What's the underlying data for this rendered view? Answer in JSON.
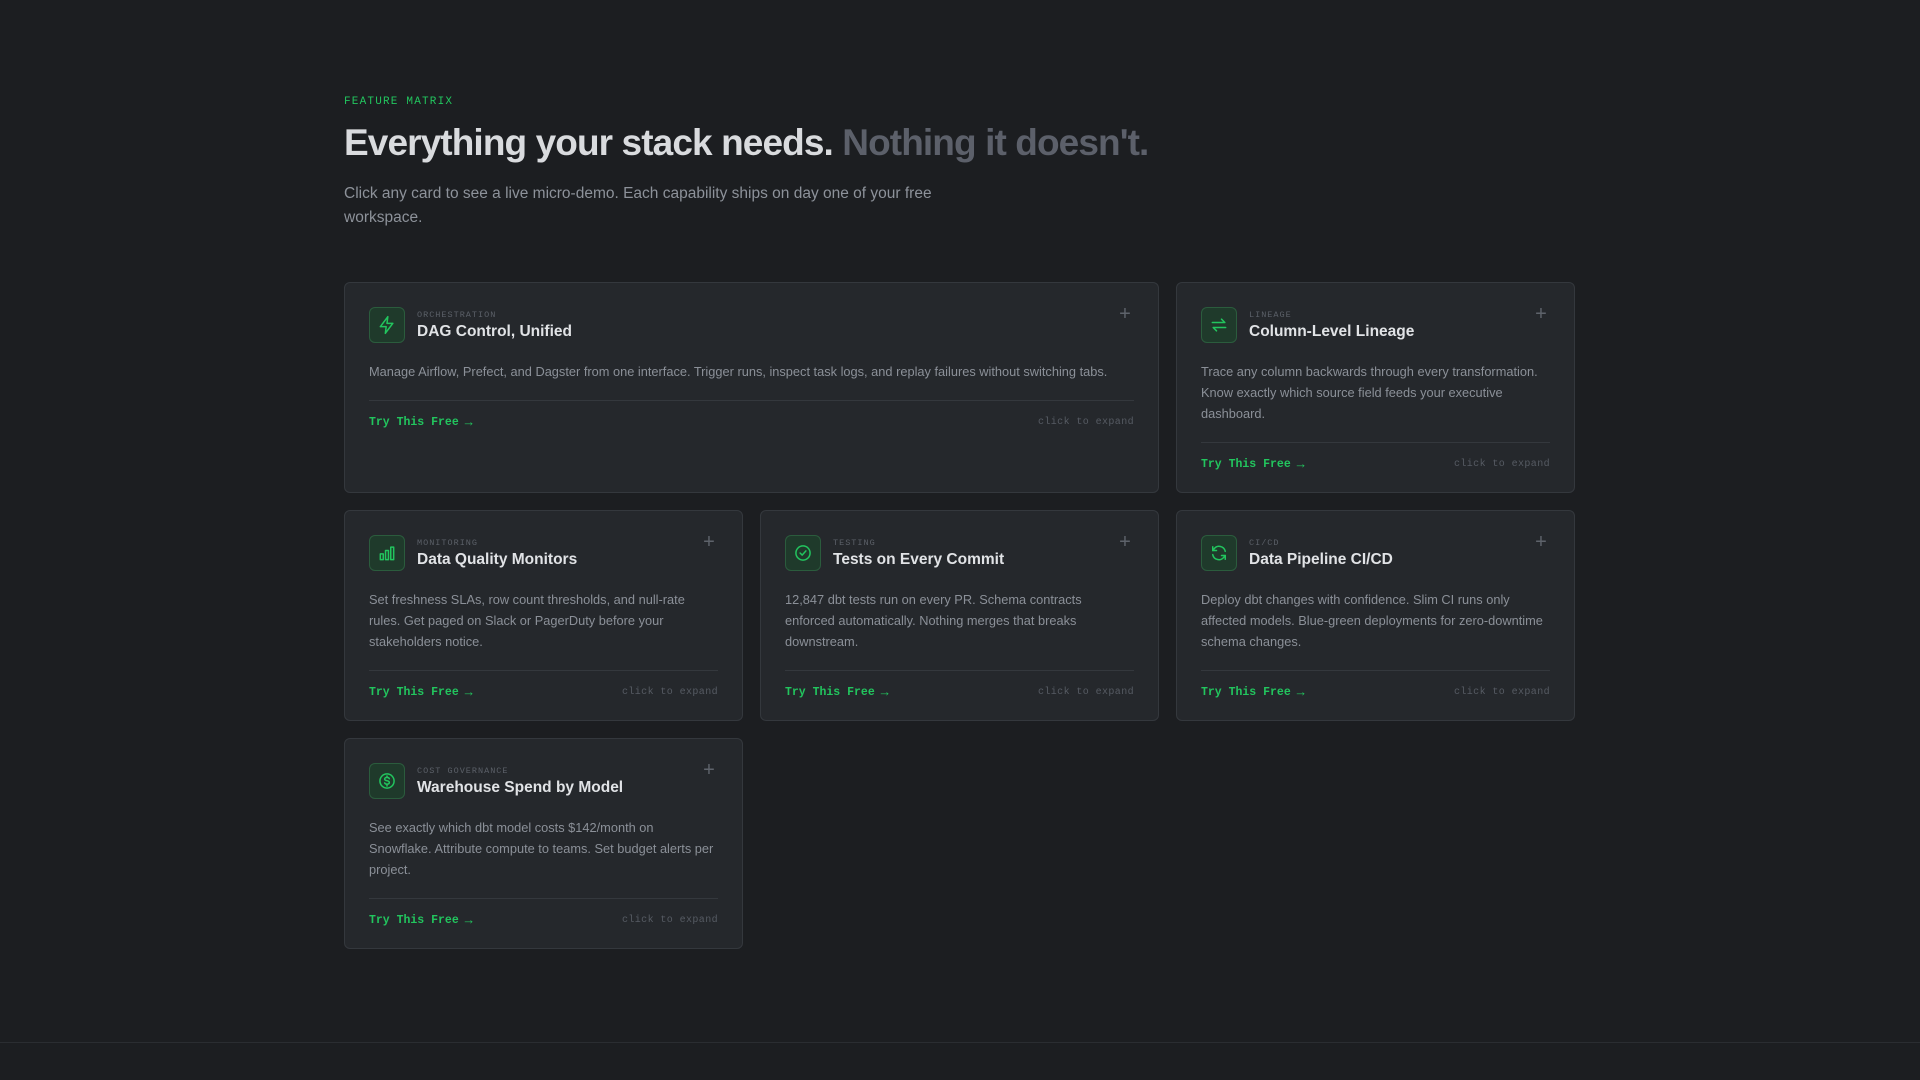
{
  "section": {
    "eyebrow": "FEATURE MATRIX",
    "headline_main": "Everything your stack needs.",
    "headline_muted": "Nothing it doesn't.",
    "subtitle": "Click any card to see a live micro-demo. Each capability ships on day one of your free workspace."
  },
  "colors": {
    "accent": "#22c55e",
    "background": "#1c1e21",
    "card": "#25282c"
  },
  "cards": [
    {
      "category": "ORCHESTRATION",
      "title": "DAG Control, Unified",
      "description": "Manage Airflow, Prefect, and Dagster from one interface. Trigger runs, inspect task logs, and replay failures without switching tabs.",
      "cta": "Try This Free",
      "cta_arrow": "→",
      "hint": "click to expand",
      "icon": "lightning-icon",
      "expand": "+"
    },
    {
      "category": "LINEAGE",
      "title": "Column-Level Lineage",
      "description": "Trace any column backwards through every transformation. Know exactly which source field feeds your executive dashboard.",
      "cta": "Try This Free",
      "cta_arrow": "→",
      "hint": "click to expand",
      "icon": "swap-arrows-icon",
      "expand": "+"
    },
    {
      "category": "MONITORING",
      "title": "Data Quality Monitors",
      "description": "Set freshness SLAs, row count thresholds, and null-rate rules. Get paged on Slack or PagerDuty before your stakeholders notice.",
      "cta": "Try This Free",
      "cta_arrow": "→",
      "hint": "click to expand",
      "icon": "bar-chart-icon",
      "expand": "+"
    },
    {
      "category": "TESTING",
      "title": "Tests on Every Commit",
      "description": "12,847 dbt tests run on every PR. Schema contracts enforced automatically. Nothing merges that breaks downstream.",
      "cta": "Try This Free",
      "cta_arrow": "→",
      "hint": "click to expand",
      "icon": "check-circle-icon",
      "expand": "+"
    },
    {
      "category": "CI/CD",
      "title": "Data Pipeline CI/CD",
      "description": "Deploy dbt changes with confidence. Slim CI runs only affected models. Blue-green deployments for zero-downtime schema changes.",
      "cta": "Try This Free",
      "cta_arrow": "→",
      "hint": "click to expand",
      "icon": "refresh-icon",
      "expand": "+"
    },
    {
      "category": "COST GOVERNANCE",
      "title": "Warehouse Spend by Model",
      "description": "See exactly which dbt model costs $142/month on Snowflake. Attribute compute to teams. Set budget alerts per project.",
      "cta": "Try This Free",
      "cta_arrow": "→",
      "hint": "click to expand",
      "icon": "dollar-circle-icon",
      "expand": "+"
    }
  ]
}
